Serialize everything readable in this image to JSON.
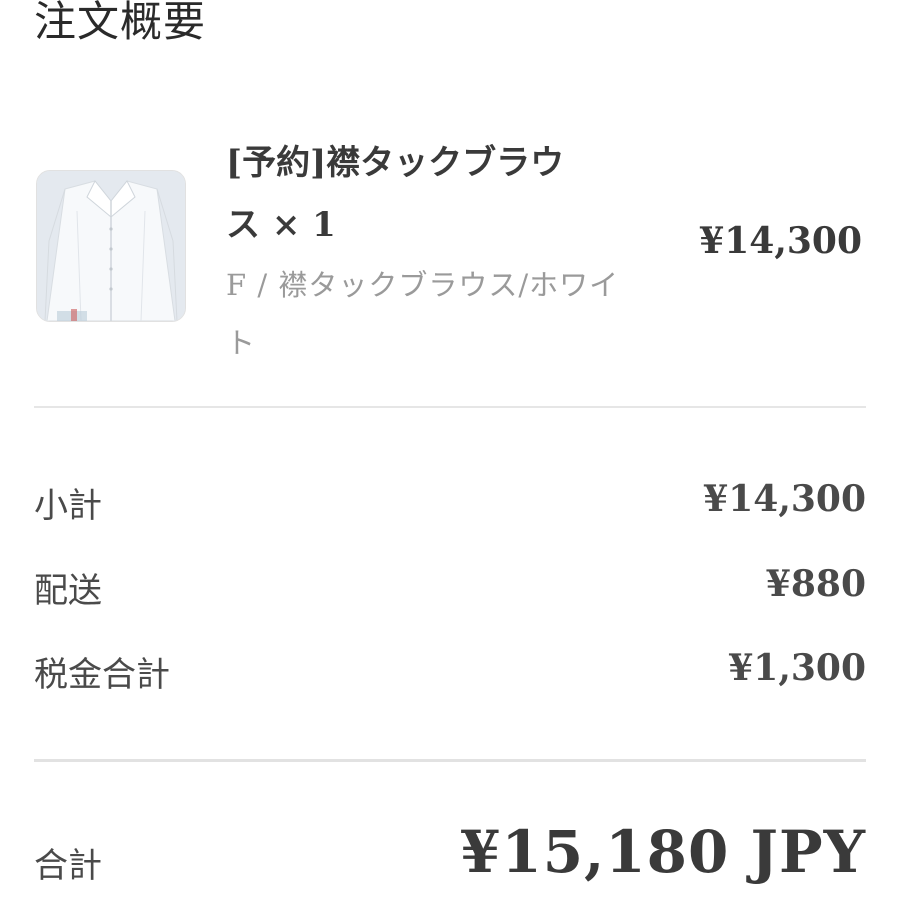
{
  "order_summary": {
    "title": "注文概要"
  },
  "product": {
    "image_alt": "襟タックブラウス ホワイト",
    "name_line1": "[予約]襟タックブラウ",
    "name_line2": "ス × 1",
    "variant_line1": "F / 襟タックブラウス/ホワイ",
    "variant_line2": "ト",
    "price": "¥14,300"
  },
  "summary": {
    "subtotal_label": "小計",
    "subtotal_value": "¥14,300",
    "shipping_label": "配送",
    "shipping_value": "¥880",
    "tax_label": "税金合計",
    "tax_value": "¥1,300"
  },
  "total": {
    "label": "合計",
    "value": "¥15,180 JPY"
  },
  "colors": {
    "background": "#ffffff",
    "text_dark": "#3a3a3a",
    "text_muted": "#9a9a9a",
    "divider": "#e6e6e6"
  }
}
